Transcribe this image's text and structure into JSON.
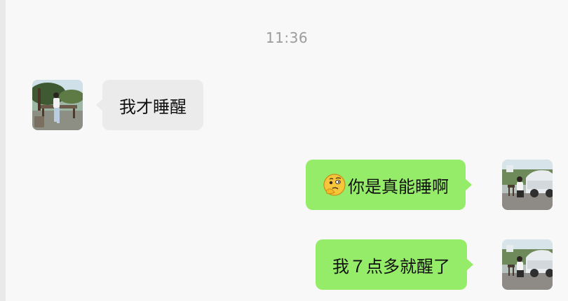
{
  "timestamp": "11:36",
  "messages": [
    {
      "side": "left",
      "text": "我才睡醒",
      "avatar": "woman-sitting-bench-avatar"
    },
    {
      "side": "right",
      "text": "你是真能睡啊",
      "emoji": "thinking-face-emoji",
      "avatar": "man-with-car-avatar"
    },
    {
      "side": "right",
      "text": "我７点多就醒了",
      "avatar": "man-with-car-avatar"
    }
  ],
  "colors": {
    "incoming_bubble": "#ebebeb",
    "outgoing_bubble": "#95ec69",
    "timestamp": "#9b9b9b",
    "background": "#f8f8f8"
  }
}
